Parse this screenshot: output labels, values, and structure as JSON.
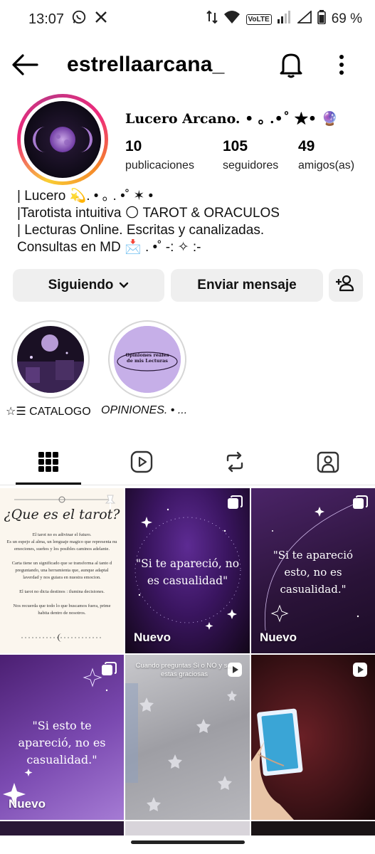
{
  "status": {
    "time": "13:07",
    "volte": "VoLTE",
    "battery": "69 %"
  },
  "header": {
    "username": "estrellaarcana_"
  },
  "profile": {
    "display_name": "Lucero Arcano. • ｡ .•˚ ★• 🔮",
    "stats": [
      {
        "value": "10",
        "label": "publicaciones"
      },
      {
        "value": "105",
        "label": "seguidores"
      },
      {
        "value": "49",
        "label": "amigos(as)"
      }
    ],
    "bio": [
      "| Lucero 💫. • ｡ . •˚ ✶ •",
      "|Tarotista intuitiva 🌕 TAROT & ORACULOS",
      "| Lecturas Online. Escritas y canalizadas.",
      "Consultas en MD 📩 . •˚ -: ✧ :-"
    ]
  },
  "actions": {
    "following": "Siguiendo",
    "message": "Enviar mensaje"
  },
  "highlights": [
    {
      "label": "☆☰ CATALOGO",
      "image_text": ""
    },
    {
      "label": "OPINIONES. • ...",
      "image_text": "Opiniones reales de mis Lecturas"
    }
  ],
  "tabs": [
    "posts-grid",
    "reels",
    "reposts",
    "tagged"
  ],
  "grid": {
    "post1": {
      "title": "¿Que es el tarot?",
      "lines": [
        "El tarot no es adivinar el futuro.",
        "Es un espejo al alma, un lenguaje magico que representa nu",
        "emociones, sueños y los posibles caminos adelante.",
        "Carta tiene un significado que se transforma al tanto d",
        "preguntando, una herramienta que, aunque adaptal",
        "laverdad y nos guiara en nuestra emocion.",
        "El tarot no dicta destinos : ilumina decisiones.",
        "Nos recuerda que todo lo que buscamos fuera, prime",
        "habita dentro de nosotros."
      ]
    },
    "post2": {
      "quote": "\"Si te apareció, no es casualidad\"",
      "badge": "Nuevo"
    },
    "post3": {
      "quote": "\"Si te apareció esto, no es casualidad.\"",
      "badge": "Nuevo"
    },
    "post4": {
      "quote": "\"Si esto te apareció, no es casualidad.\"",
      "badge": "Nuevo"
    },
    "post5": {
      "caption": "Cuando preguntas Si o NO y s... estas graciosas"
    },
    "post6": {
      "caption": ""
    }
  },
  "colors": {
    "accent_purple": "#5b2a86",
    "button_bg": "#efefef"
  }
}
